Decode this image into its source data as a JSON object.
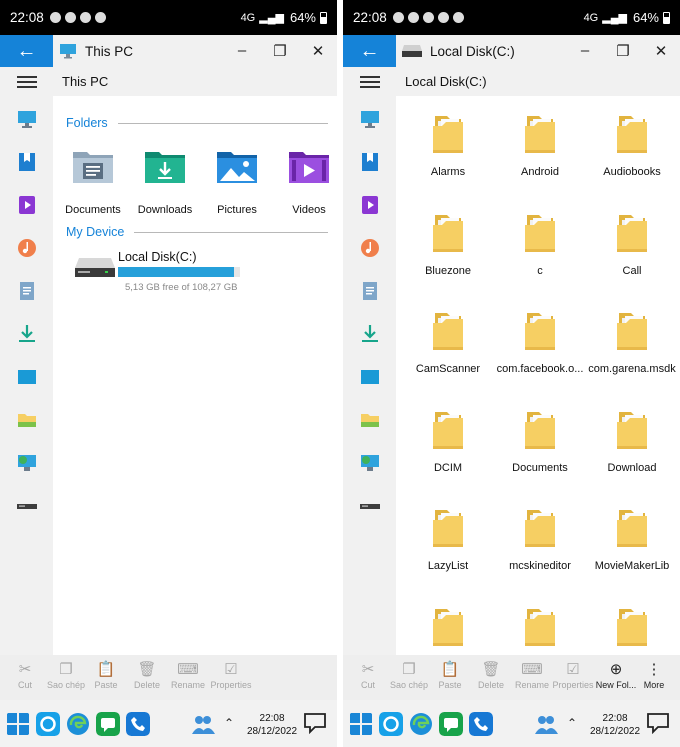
{
  "status": {
    "time": "22:08",
    "battery": "64%",
    "network": "4G"
  },
  "left": {
    "title": "This PC",
    "address": "This PC",
    "sections": {
      "folders": "Folders",
      "device": "My Device"
    },
    "quick_folders": [
      {
        "label": "Documents",
        "icon": "documents-folder-icon"
      },
      {
        "label": "Downloads",
        "icon": "downloads-folder-icon"
      },
      {
        "label": "Pictures",
        "icon": "pictures-folder-icon"
      },
      {
        "label": "Videos",
        "icon": "videos-folder-icon"
      }
    ],
    "disk": {
      "name": "Local Disk(C:)",
      "free_text": "5,13 GB free of 108,27 GB",
      "used_fraction": 0.953
    }
  },
  "right": {
    "title": "Local Disk(C:)",
    "address": "Local Disk(C:)",
    "folders": [
      "Alarms",
      "Android",
      "Audiobooks",
      "Bluezone",
      "c",
      "Call",
      "CamScanner",
      "com.facebook.o...",
      "com.garena.msdk",
      "DCIM",
      "Documents",
      "Download",
      "LazyList",
      "mcskineditor",
      "MovieMakerLib",
      "",
      "",
      ""
    ]
  },
  "actions": {
    "cut": "Cut",
    "copy": "Sao chép",
    "paste": "Paste",
    "delete": "Delete",
    "rename": "Rename",
    "properties": "Properties",
    "new_folder": "New Fol...",
    "more": "More"
  },
  "taskbar": {
    "time": "22:08",
    "date": "28/12/2022"
  },
  "colors": {
    "accent": "#1583d8",
    "folder": "#f6cf63",
    "sidebar": "#f1f1f1"
  }
}
